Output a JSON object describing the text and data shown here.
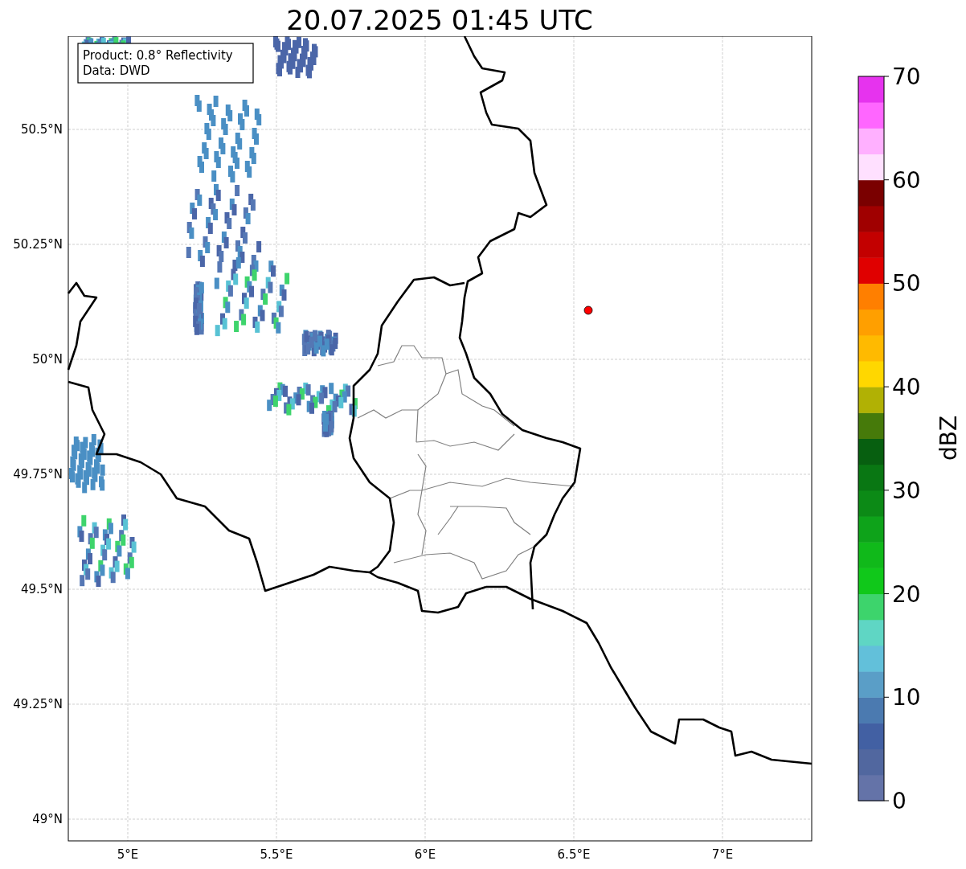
{
  "title": "20.07.2025 01:45 UTC",
  "info_box": {
    "lines": [
      "Product: 0.8° Reflectivity",
      "Data: DWD"
    ]
  },
  "map": {
    "lat_ticks": [
      "50.5°N",
      "50.25°N",
      "50°N",
      "49.75°N",
      "49.5°N",
      "49.25°N",
      "49°N"
    ],
    "lon_ticks": [
      "5°E",
      "5.5°E",
      "6°E",
      "6.5°E",
      "7°E"
    ]
  },
  "colorbar": {
    "label": "dBZ",
    "ticks": [
      "70",
      "60",
      "50",
      "40",
      "30",
      "20",
      "10",
      "0"
    ],
    "bands": [
      {
        "color": "#6473a8"
      },
      {
        "color": "#51679f"
      },
      {
        "color": "#4260a3"
      },
      {
        "color": "#4b7ab0"
      },
      {
        "color": "#5a9ec7"
      },
      {
        "color": "#62c0da"
      },
      {
        "color": "#5fd6c4"
      },
      {
        "color": "#3dd46c"
      },
      {
        "color": "#10c81a"
      },
      {
        "color": "#10b91a"
      },
      {
        "color": "#0ea31a"
      },
      {
        "color": "#0c8a16"
      },
      {
        "color": "#097713"
      },
      {
        "color": "#075f10"
      },
      {
        "color": "#467a0a"
      },
      {
        "color": "#b1b104"
      },
      {
        "color": "#ffd700"
      },
      {
        "color": "#ffba00"
      },
      {
        "color": "#ff9f00"
      },
      {
        "color": "#ff7f00"
      },
      {
        "color": "#e00000"
      },
      {
        "color": "#c30000"
      },
      {
        "color": "#a00000"
      },
      {
        "color": "#7a0000"
      },
      {
        "color": "#ffe0ff"
      },
      {
        "color": "#ffb0ff"
      },
      {
        "color": "#ff66ff"
      },
      {
        "color": "#e633ee"
      }
    ]
  }
}
